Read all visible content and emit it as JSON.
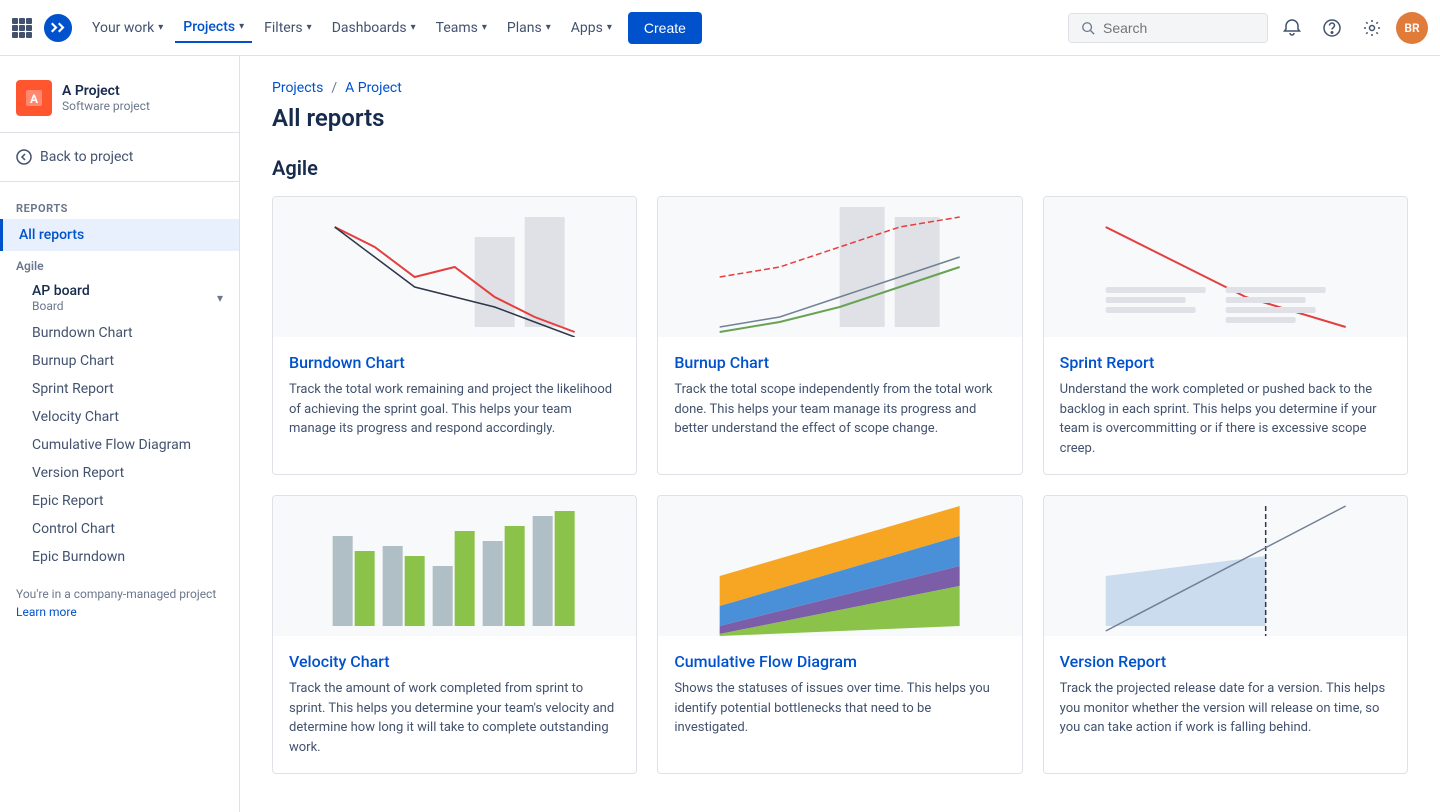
{
  "topNav": {
    "logoText": "Jira",
    "items": [
      {
        "label": "Your work",
        "hasDropdown": true,
        "active": false
      },
      {
        "label": "Projects",
        "hasDropdown": true,
        "active": true
      },
      {
        "label": "Filters",
        "hasDropdown": true,
        "active": false
      },
      {
        "label": "Dashboards",
        "hasDropdown": true,
        "active": false
      },
      {
        "label": "Teams",
        "hasDropdown": true,
        "active": false
      },
      {
        "label": "Plans",
        "hasDropdown": true,
        "active": false
      },
      {
        "label": "Apps",
        "hasDropdown": true,
        "active": false
      }
    ],
    "createLabel": "Create",
    "searchPlaceholder": "Search",
    "avatarText": "BR"
  },
  "sidebar": {
    "projectName": "A Project",
    "projectType": "Software project",
    "backLabel": "Back to project",
    "sectionLabel": "Reports",
    "allReportsLabel": "All reports",
    "agileLabel": "Agile",
    "boardLabel": "AP board",
    "boardSubLabel": "Board",
    "subItems": [
      "Burndown Chart",
      "Burnup Chart",
      "Sprint Report",
      "Velocity Chart",
      "Cumulative Flow Diagram",
      "Version Report",
      "Epic Report",
      "Control Chart",
      "Epic Burndown"
    ],
    "footerText": "You're in a company-managed project",
    "footerLink": "Learn more"
  },
  "breadcrumb": {
    "items": [
      "Projects",
      "A Project"
    ],
    "separator": "/"
  },
  "pageTitle": "All reports",
  "sections": [
    {
      "title": "Agile",
      "reports": [
        {
          "name": "Burndown Chart",
          "description": "Track the total work remaining and project the likelihood of achieving the sprint goal. This helps your team manage its progress and respond accordingly.",
          "chartType": "burndown"
        },
        {
          "name": "Burnup Chart",
          "description": "Track the total scope independently from the total work done. This helps your team manage its progress and better understand the effect of scope change.",
          "chartType": "burnup"
        },
        {
          "name": "Sprint Report",
          "description": "Understand the work completed or pushed back to the backlog in each sprint. This helps you determine if your team is overcommitting or if there is excessive scope creep.",
          "chartType": "sprint"
        },
        {
          "name": "Velocity Chart",
          "description": "Track the amount of work completed from sprint to sprint. This helps you determine your team's velocity and determine how long it will take to complete outstanding work.",
          "chartType": "velocity"
        },
        {
          "name": "Cumulative Flow Diagram",
          "description": "Shows the statuses of issues over time. This helps you identify potential bottlenecks that need to be investigated.",
          "chartType": "cfd"
        },
        {
          "name": "Version Report",
          "description": "Track the projected release date for a version. This helps you monitor whether the version will release on time, so you can take action if work is falling behind.",
          "chartType": "version"
        }
      ]
    }
  ]
}
